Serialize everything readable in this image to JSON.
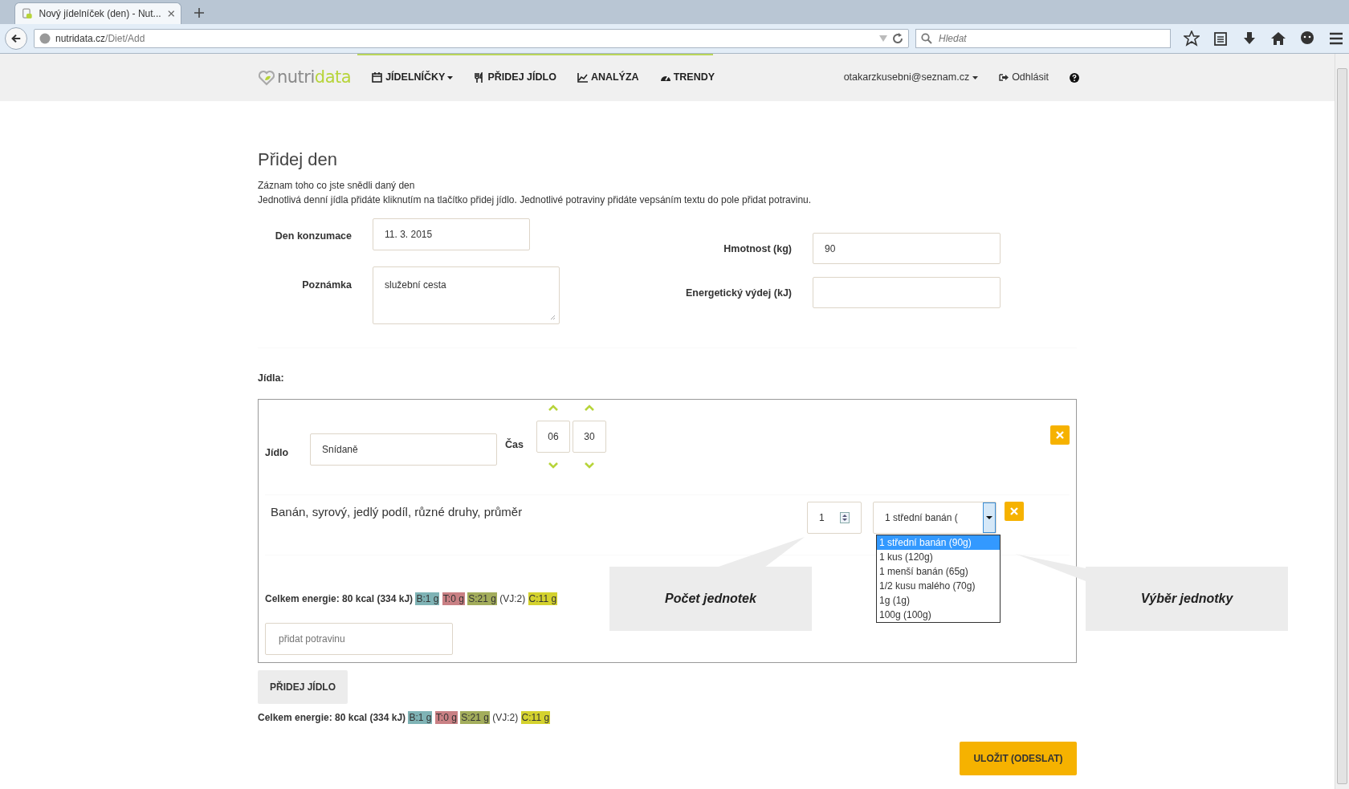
{
  "browser": {
    "tab_title": "Nový jídelníček (den) - Nut...",
    "url_host": "nutridata.cz",
    "url_path": "/Diet/Add",
    "search_placeholder": "Hledat"
  },
  "header": {
    "logo": {
      "first": "nutri",
      "second": "data"
    },
    "nav": [
      {
        "label": "JÍDELNÍČKY",
        "caret": true
      },
      {
        "label": "PŘIDEJ JÍDLO",
        "caret": false
      },
      {
        "label": "ANALÝZA",
        "caret": false
      },
      {
        "label": "TRENDY",
        "caret": false
      }
    ],
    "user": "otakarzkusebni@seznam.cz",
    "logout": "Odhlásit"
  },
  "page": {
    "title": "Přidej den",
    "intro": [
      "Záznam toho co jste snědli daný den",
      "Jednotlivá denní jídla přidáte kliknutím na tlačítko přidej jídlo. Jednotlivé potraviny přidáte vepsáním textu do pole přidat potravinu."
    ]
  },
  "form_left": [
    {
      "label": "Den konzumace",
      "value": "11. 3. 2015",
      "kind": "input"
    },
    {
      "label": "Poznámka",
      "value": "služební cesta",
      "kind": "textarea"
    }
  ],
  "form_right": [
    {
      "label": "Hmotnost (kg)",
      "value": "90"
    },
    {
      "label": "Energetický výdej (kJ)"
    }
  ],
  "meals_label": "Jídla:",
  "meal": {
    "label": "Jídlo",
    "value": "Snídaně",
    "time_label": "Čas",
    "hour": "06",
    "minute": "30",
    "food": {
      "name": "Banán, syrový, jedlý podíl, různé druhy, průměr",
      "quantity": "1",
      "unit": "1 střední banán (",
      "options": [
        {
          "label": "1 střední banán (90g)",
          "selected": true
        },
        {
          "label": "1 kus (120g)",
          "selected": false
        },
        {
          "label": "1 menší banán (65g)",
          "selected": false
        },
        {
          "label": "1/2 kusu malého (70g)",
          "selected": false
        },
        {
          "label": "1g (1g)",
          "selected": false
        },
        {
          "label": "100g (100g)",
          "selected": false
        }
      ]
    },
    "energy": {
      "label": "Celkem energie: 80 kcal (334 kJ)",
      "parts": [
        {
          "text": "B:1 g",
          "kind": "tag",
          "color": "#7fb3b5"
        },
        {
          "text": "T:0 g",
          "kind": "tag",
          "color": "#c98084"
        },
        {
          "text": "S:21 g",
          "kind": "tag",
          "color": "#a3ad5c"
        },
        {
          "text": "(VJ:2)",
          "kind": "plain"
        },
        {
          "text": "C:11 g",
          "kind": "tag",
          "color": "#d4d22e"
        }
      ]
    },
    "add_food_placeholder": "přidat potravinu"
  },
  "callouts": [
    "Počet jednotek",
    "Výběr jednotky"
  ],
  "add_meal_button": "PŘIDEJ JÍDLO",
  "total": {
    "label": "Celkem energie: 80 kcal (334 kJ)",
    "parts": [
      {
        "text": "B:1 g",
        "kind": "tag",
        "color": "#7fb3b5"
      },
      {
        "text": "T:0 g",
        "kind": "tag",
        "color": "#c98084"
      },
      {
        "text": "S:21 g",
        "kind": "tag",
        "color": "#a3ad5c"
      },
      {
        "text": "(VJ:2)",
        "kind": "plain"
      },
      {
        "text": "C:11 g",
        "kind": "tag",
        "color": "#d4d22e"
      }
    ]
  },
  "save_button": "ULOŽIT (ODESLAT)"
}
